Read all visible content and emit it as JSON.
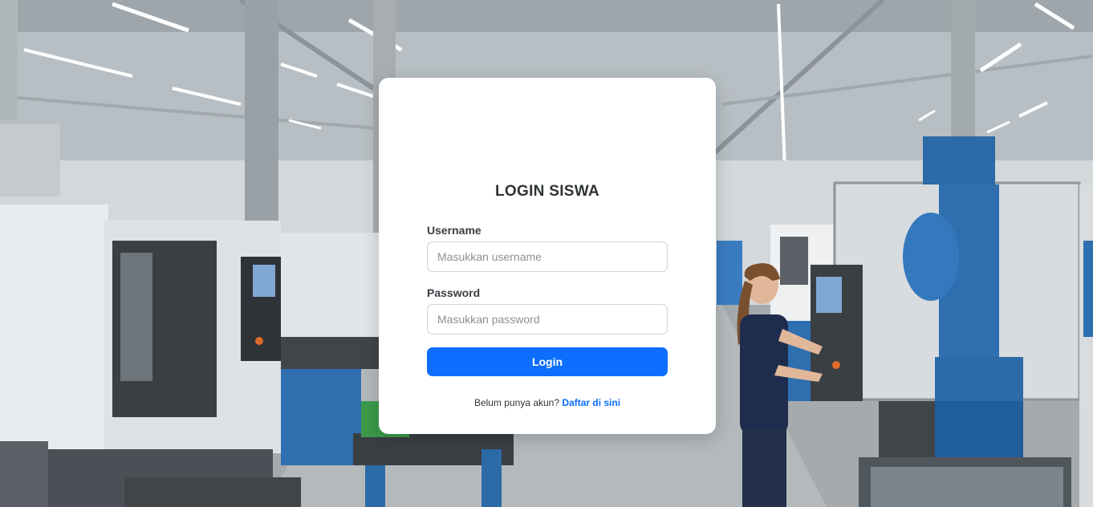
{
  "page": {
    "title": "LOGIN SISWA"
  },
  "form": {
    "username_label": "Username",
    "username_placeholder": "Masukkan username",
    "username_value": "",
    "password_label": "Password",
    "password_placeholder": "Masukkan password",
    "password_value": "",
    "submit_label": "Login"
  },
  "signup": {
    "prompt": "Belum punya akun?",
    "link_label": "Daftar di sini"
  },
  "colors": {
    "primary": "#0d6efd",
    "card_bg": "#ffffff",
    "title_text": "#2f3437"
  },
  "background": {
    "description_icon": "factory-background-image"
  }
}
